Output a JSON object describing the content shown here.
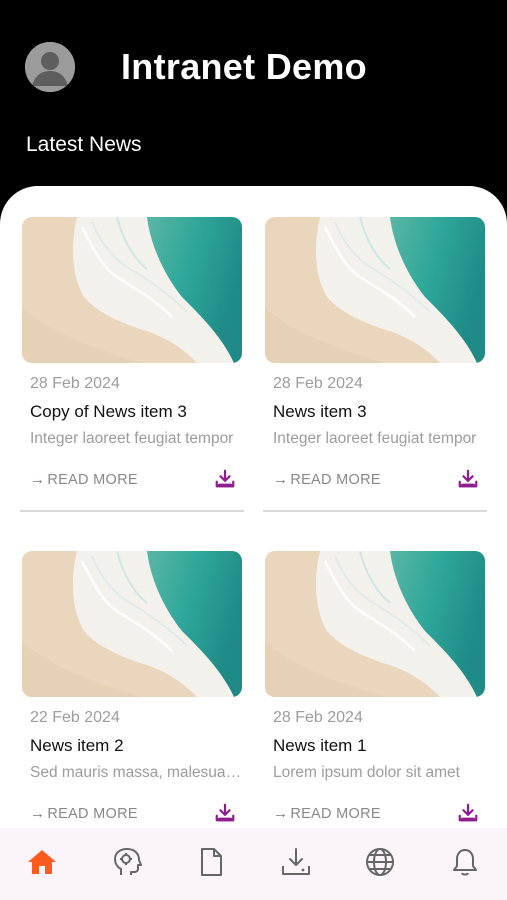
{
  "header": {
    "app_title": "Intranet Demo",
    "section_title": "Latest News"
  },
  "news": [
    {
      "date": "28 Feb 2024",
      "title": "Copy of News item 3",
      "excerpt": "Integer laoreet feugiat tempor",
      "read_more": "READ MORE"
    },
    {
      "date": "28 Feb 2024",
      "title": "News item 3",
      "excerpt": "Integer laoreet feugiat tempor",
      "read_more": "READ MORE"
    },
    {
      "date": "22 Feb 2024",
      "title": "News item 2",
      "excerpt": "Sed mauris massa, malesuada",
      "read_more": "READ MORE"
    },
    {
      "date": "28 Feb 2024",
      "title": "News item 1",
      "excerpt": "Lorem ipsum dolor sit amet",
      "read_more": "READ MORE"
    }
  ],
  "bottom_nav": [
    {
      "icon": "home-icon",
      "active": true
    },
    {
      "icon": "head-icon",
      "active": false
    },
    {
      "icon": "document-icon",
      "active": false
    },
    {
      "icon": "download-icon",
      "active": false
    },
    {
      "icon": "globe-icon",
      "active": false
    },
    {
      "icon": "bell-icon",
      "active": false
    }
  ],
  "colors": {
    "accent": "#ff5a1f",
    "download": "#8e1e8e",
    "nav_bg": "#fbf5fb"
  }
}
